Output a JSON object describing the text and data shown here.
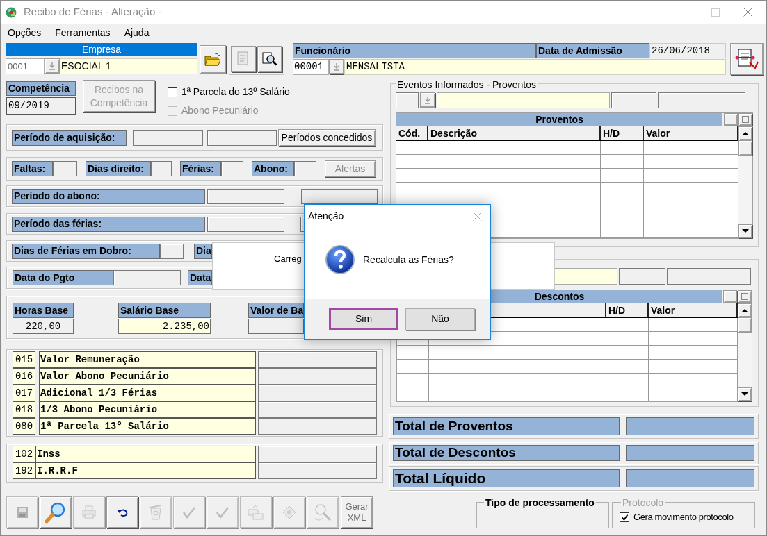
{
  "window": {
    "title": "Recibo de Férias - Alteração -"
  },
  "menu": [
    {
      "label": "Opções"
    },
    {
      "label": "Ferramentas"
    },
    {
      "label": "Ajuda"
    }
  ],
  "empresa": {
    "header": "Empresa",
    "code": "0001",
    "name": "ESOCIAL 1"
  },
  "funcionario": {
    "header": "Funcionário",
    "code": "00001",
    "name": "MENSALISTA",
    "admission_label": "Data de Admissão",
    "admission_date": "26/06/2018"
  },
  "competencia": {
    "label": "Competência",
    "value": "09/2019"
  },
  "recibos_button": {
    "label": "Recibos na Competência",
    "disabled": true
  },
  "options": [
    {
      "label": "1ª Parcela do 13º Salário",
      "checked": false,
      "disabled": false
    },
    {
      "label": "Abono Pecuniário",
      "checked": false,
      "disabled": true
    }
  ],
  "periodo_aquisicao": {
    "label": "Período de aquisição:",
    "button": "Períodos concedidos"
  },
  "counts": [
    {
      "label": "Faltas:"
    },
    {
      "label": "Dias direito:"
    },
    {
      "label": "Férias:"
    },
    {
      "label": "Abono:"
    }
  ],
  "alertas_button": {
    "label": "Alertas",
    "disabled": true
  },
  "periodo_abono": {
    "label": "Período do abono:"
  },
  "periodo_ferias": {
    "label": "Período das férias:"
  },
  "dobro": {
    "label": "Dias de Férias em Dobro:",
    "label_2": "Dia"
  },
  "pagamento": {
    "label": "Data do Pgto",
    "label_2": "Data"
  },
  "bases": [
    {
      "label": "Horas Base",
      "value": "220,00"
    },
    {
      "label": "Salário Base",
      "value": "2.235,00"
    },
    {
      "label": "Valor de Ba"
    }
  ],
  "earnings": [
    {
      "code": "015",
      "description": "Valor Remuneração"
    },
    {
      "code": "016",
      "description": "Valor Abono Pecuniário"
    },
    {
      "code": "017",
      "description": "Adicional 1/3 Férias"
    },
    {
      "code": "018",
      "description": "1/3 Abono Pecuniário"
    },
    {
      "code": "080",
      "description": "1ª Parcela 13º Salário"
    }
  ],
  "deductions": [
    {
      "code": "102",
      "description": "Inss"
    },
    {
      "code": "192",
      "description": "I.R.R.F"
    }
  ],
  "toolbar": [
    {
      "disabled": true
    },
    {
      "disabled": false
    },
    {
      "disabled": true
    },
    {
      "disabled": false
    },
    {
      "disabled": true
    },
    {
      "disabled": true
    },
    {
      "disabled": true
    },
    {
      "disabled": true
    },
    {
      "disabled": true
    },
    {
      "disabled": true
    },
    {
      "label": "Gerar XML",
      "disabled": true
    }
  ],
  "proventos": {
    "group_title": "Eventos Informados - Proventos",
    "grid_title": "Proventos",
    "columns": [
      "Cód.",
      "Descrição",
      "H/D",
      "Valor"
    ]
  },
  "descontos": {
    "grid_title": "Descontos",
    "columns": [
      "H/D",
      "Valor"
    ]
  },
  "totals": [
    {
      "label": "Total de Proventos"
    },
    {
      "label": "Total de Descontos"
    },
    {
      "label": "Total Líquido"
    }
  ],
  "tipo_processamento": {
    "title": "Tipo de processamento"
  },
  "protocolo": {
    "title": "Protocolo",
    "disabled": true,
    "checkbox": {
      "label": "Gera movimento protocolo",
      "checked": true
    }
  },
  "loading": {
    "text": "Carreg"
  },
  "dialog": {
    "title": "Atenção",
    "message": "Recalcula as Férias?",
    "buttons": [
      {
        "label": "Sim",
        "focused": true
      },
      {
        "label": "Não",
        "focused": false
      }
    ]
  }
}
